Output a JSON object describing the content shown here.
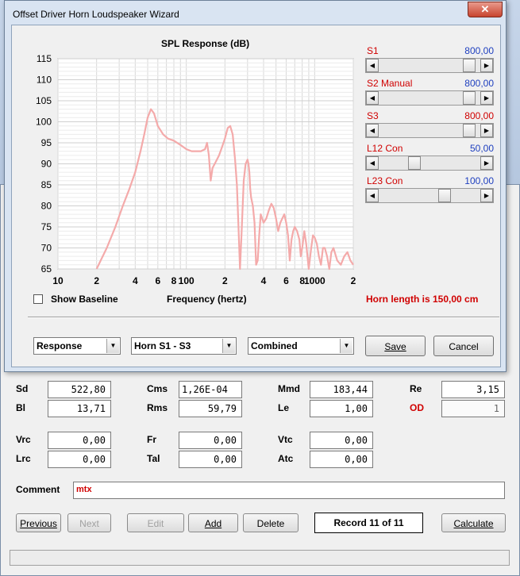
{
  "dialog": {
    "title": "Offset Driver Horn Loudspeaker Wizard",
    "close_label": "✕",
    "chart_title": "SPL Response (dB)",
    "xlabel": "Frequency (hertz)",
    "show_baseline_label": "Show Baseline",
    "horn_length": "Horn length is 150,00 cm",
    "sliders": [
      {
        "label": "S1",
        "value": "800,00",
        "position": 0.95,
        "value_color": "#1e3fbf",
        "label_color": "#d00000"
      },
      {
        "label": "S2  Manual",
        "value": "800,00",
        "position": 0.95,
        "value_color": "#1e3fbf",
        "label_color": "#d00000"
      },
      {
        "label": "S3",
        "value": "800,00",
        "position": 0.95,
        "value_color": "#d00000",
        "label_color": "#d00000"
      },
      {
        "label": "L12  Con",
        "value": "50,00",
        "position": 0.33,
        "value_color": "#1e3fbf",
        "label_color": "#d00000"
      },
      {
        "label": "L23  Con",
        "value": "100,00",
        "position": 0.67,
        "value_color": "#1e3fbf",
        "label_color": "#d00000"
      }
    ],
    "combos": {
      "response": "Response",
      "horn": "Horn S1 - S3",
      "mode": "Combined"
    },
    "save_label": "Save",
    "cancel_label": "Cancel"
  },
  "chart_data": {
    "type": "line",
    "title": "SPL Response (dB)",
    "xlabel": "Frequency (hertz)",
    "ylabel": "",
    "x_scale": "log",
    "xlim": [
      10,
      2000
    ],
    "ylim": [
      65,
      115
    ],
    "grid": true,
    "ytick_labels": [
      "115",
      "110",
      "105",
      "100",
      "95",
      "90",
      "85",
      "80",
      "75",
      "70",
      "65"
    ],
    "xtick_labels": [
      {
        "value": 10,
        "label": "10"
      },
      {
        "value": 20,
        "label": "2"
      },
      {
        "value": 40,
        "label": "4"
      },
      {
        "value": 60,
        "label": "6"
      },
      {
        "value": 80,
        "label": "8"
      },
      {
        "value": 100,
        "label": "100"
      },
      {
        "value": 200,
        "label": "2"
      },
      {
        "value": 400,
        "label": "4"
      },
      {
        "value": 600,
        "label": "6"
      },
      {
        "value": 800,
        "label": "8"
      },
      {
        "value": 1000,
        "label": "1000"
      },
      {
        "value": 2000,
        "label": "2"
      }
    ],
    "line_color": "#f4aaaa",
    "series": [
      {
        "x": [
          20,
          24,
          28,
          32,
          36,
          40,
          44,
          47,
          50,
          53,
          56,
          60,
          66,
          72,
          80,
          90,
          100,
          110,
          120,
          130,
          140,
          145,
          150,
          155,
          160,
          170,
          180,
          190,
          200,
          210,
          220,
          230,
          240,
          248,
          255,
          262,
          270,
          280,
          290,
          300,
          305,
          310,
          315,
          320,
          330,
          340,
          350,
          360,
          370,
          380,
          390,
          400,
          420,
          440,
          460,
          480,
          500,
          520,
          540,
          560,
          580,
          600,
          620,
          640,
          660,
          680,
          700,
          730,
          760,
          780,
          800,
          830,
          860,
          900,
          940,
          970,
          1000,
          1040,
          1080,
          1120,
          1160,
          1200,
          1250,
          1300,
          1350,
          1400,
          1500,
          1600,
          1700,
          1800,
          1900,
          2000
        ],
        "y": [
          65,
          70,
          75,
          80,
          84,
          88,
          93,
          97,
          101,
          103,
          102,
          99,
          97,
          96,
          95.5,
          94.5,
          93.5,
          93,
          93,
          93,
          93.5,
          95,
          92,
          86,
          89,
          90.5,
          92,
          94,
          96,
          98.5,
          99,
          97,
          91,
          85,
          75,
          65,
          74,
          86,
          90,
          91,
          90,
          88,
          84,
          82,
          80,
          76,
          66,
          67,
          73,
          78,
          77,
          76,
          77,
          79,
          80.5,
          79.5,
          77,
          74,
          76,
          77,
          78,
          76,
          73,
          67,
          72,
          74,
          75,
          74,
          72,
          68,
          70,
          74,
          71,
          65,
          70,
          73,
          72.5,
          71,
          68,
          66,
          70,
          70,
          68,
          65,
          69,
          70,
          67,
          66,
          68,
          69,
          67,
          66
        ]
      }
    ]
  },
  "form": {
    "labels": {
      "sd": "Sd",
      "bl": "Bl",
      "cms": "Cms",
      "rms": "Rms",
      "mmd": "Mmd",
      "le": "Le",
      "re": "Re",
      "od": "OD",
      "vrc": "Vrc",
      "lrc": "Lrc",
      "fr": "Fr",
      "tal": "Tal",
      "vtc": "Vtc",
      "atc": "Atc",
      "comment": "Comment"
    },
    "values": {
      "sd": "522,80",
      "bl": "13,71",
      "cms": "1,26E-04",
      "rms": "59,79",
      "mmd": "183,44",
      "le": "1,00",
      "re": "3,15",
      "od": "1",
      "vrc": "0,00",
      "lrc": "0,00",
      "fr": "0,00",
      "tal": "0,00",
      "vtc": "0,00",
      "atc": "0,00",
      "comment": "mtx"
    },
    "buttons": {
      "previous": "Previous",
      "next": "Next",
      "edit": "Edit",
      "add": "Add",
      "delete": "Delete",
      "calculate": "Calculate"
    },
    "record": "Record 11 of 11"
  }
}
